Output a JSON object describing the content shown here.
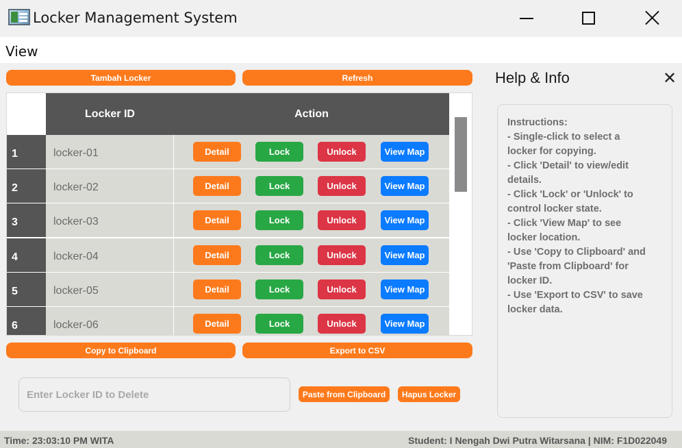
{
  "window": {
    "title": "Locker Management System",
    "icons": [
      "app-icon",
      "minimize-icon",
      "maximize-icon",
      "close-icon"
    ]
  },
  "menubar": {
    "items": [
      {
        "label": "View"
      }
    ]
  },
  "toolbar": {
    "add_label": "Tambah Locker",
    "refresh_label": "Refresh"
  },
  "table": {
    "headers": {
      "id": "Locker ID",
      "action": "Action"
    },
    "rows": [
      {
        "num": "1",
        "id": "locker-01"
      },
      {
        "num": "2",
        "id": "locker-02"
      },
      {
        "num": "3",
        "id": "locker-03"
      },
      {
        "num": "4",
        "id": "locker-04"
      },
      {
        "num": "5",
        "id": "locker-05"
      },
      {
        "num": "6",
        "id": "locker-06"
      }
    ],
    "actions": {
      "detail": "Detail",
      "lock": "Lock",
      "unlock": "Unlock",
      "map": "View Map"
    },
    "colors": {
      "header": "#555555",
      "row": "#dadad4",
      "detail": "#fd7a1c",
      "lock": "#28a745",
      "unlock": "#dc3545",
      "map": "#0b7bff"
    }
  },
  "bottom": {
    "copy_label": "Copy to Clipboard",
    "export_label": "Export to CSV",
    "delete_placeholder": "Enter Locker ID to Delete",
    "paste_label": "Paste from Clipboard",
    "delete_label": "Hapus Locker"
  },
  "help": {
    "title": "Help & Info",
    "close_icon": "close-icon",
    "text": "Instructions:\n- Single-click to select a\nlocker for copying.\n- Click 'Detail' to view/edit\ndetails.\n- Click 'Lock' or 'Unlock' to\ncontrol locker state.\n- Click 'View Map' to see\nlocker location.\n- Use 'Copy to Clipboard' and\n'Paste from Clipboard' for\nlocker ID.\n- Use 'Export to CSV' to save\nlocker data."
  },
  "status": {
    "time": "Time: 23:03:10 PM WITA",
    "student": "Student: I Nengah Dwi Putra Witarsana | NIM: F1D022049"
  },
  "accent": "#fd7a1c"
}
